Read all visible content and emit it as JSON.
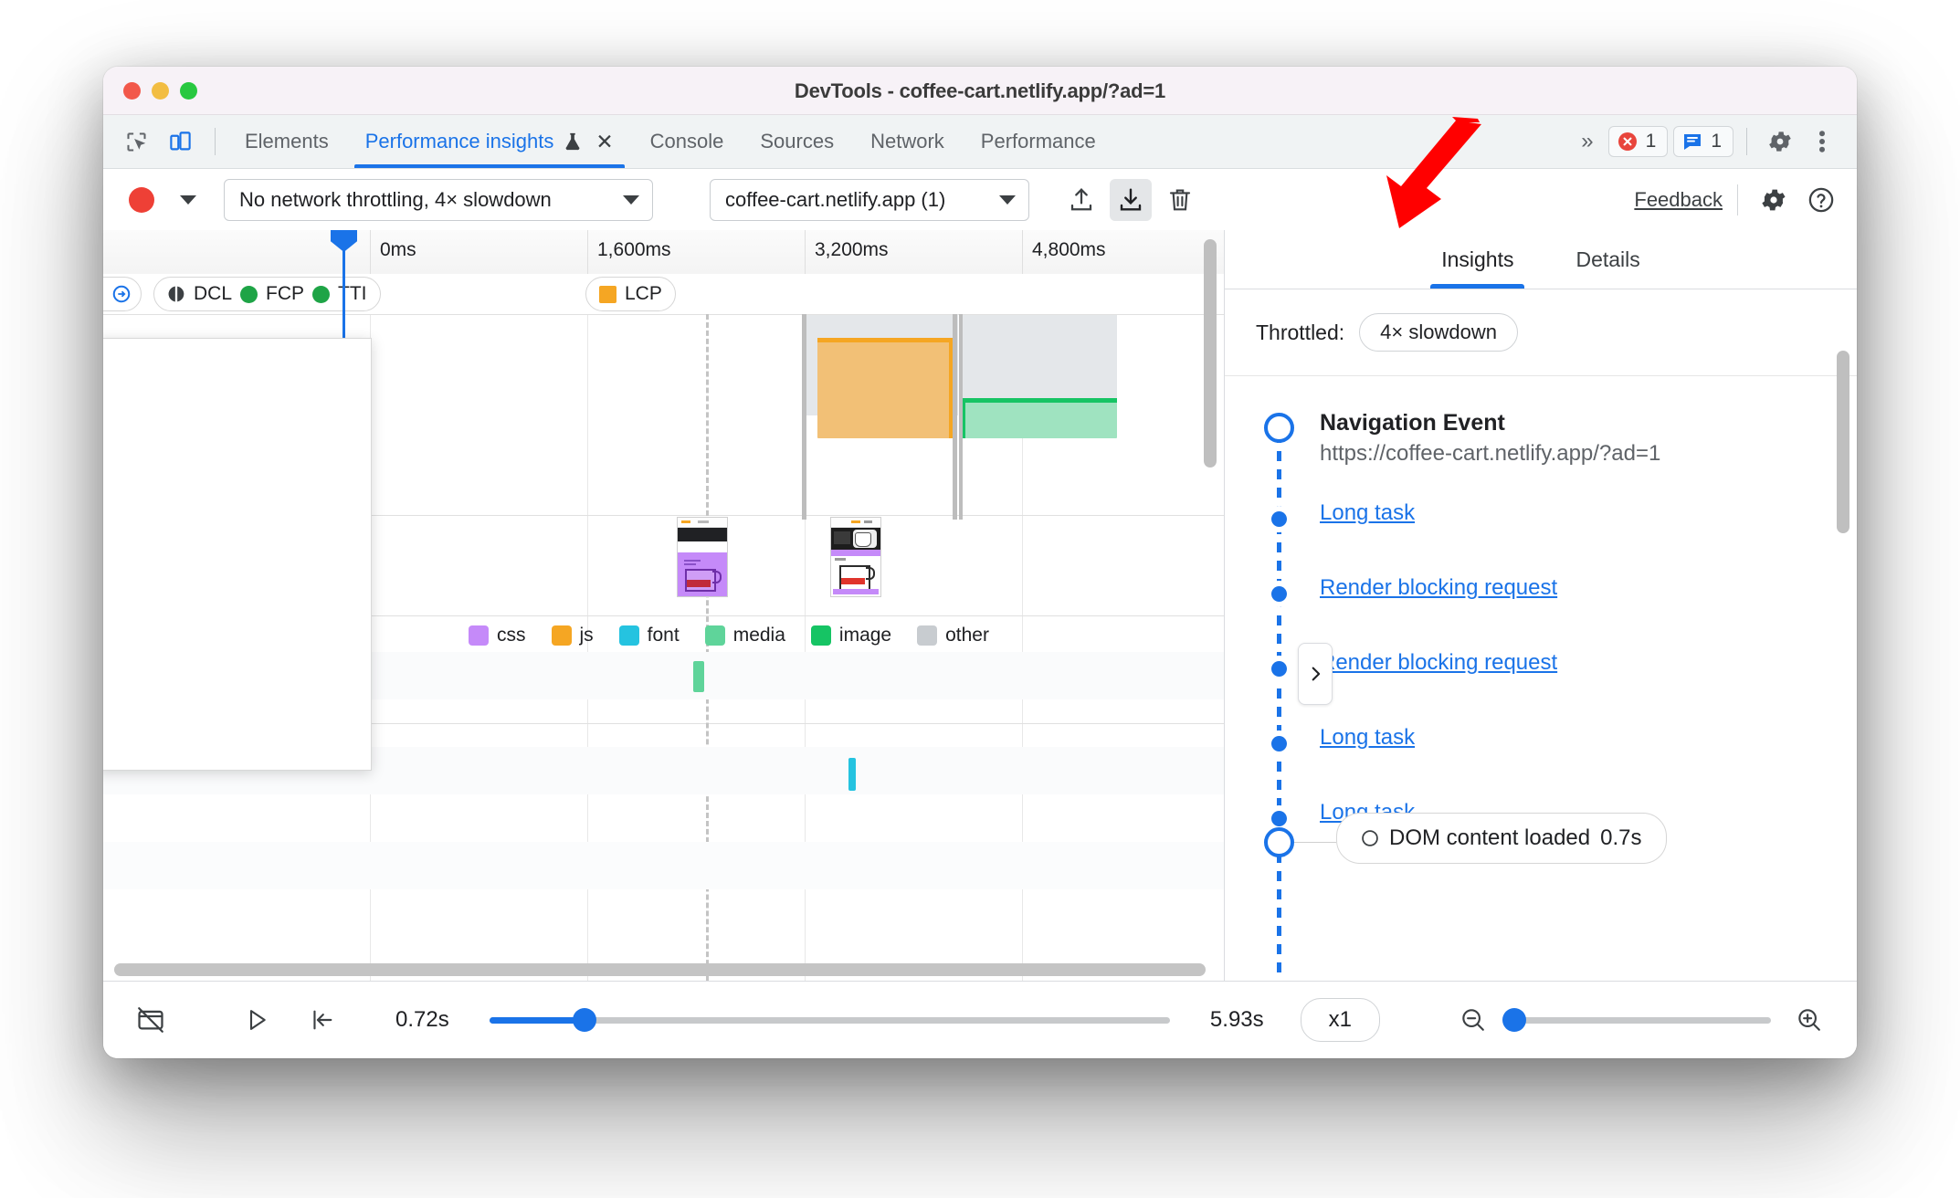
{
  "window": {
    "title": "DevTools - coffee-cart.netlify.app/?ad=1",
    "traffic_lights": [
      "close",
      "minimize",
      "zoom"
    ]
  },
  "tabstrip": {
    "left_icons": [
      "inspect-element-icon",
      "device-toolbar-icon"
    ],
    "tabs": [
      {
        "label": "Elements",
        "active": false
      },
      {
        "label": "Performance insights",
        "active": true,
        "experimental": true,
        "closable": true
      },
      {
        "label": "Console",
        "active": false
      },
      {
        "label": "Sources",
        "active": false
      },
      {
        "label": "Network",
        "active": false
      },
      {
        "label": "Performance",
        "active": false
      }
    ],
    "overflow_label": "»",
    "error_count": "1",
    "message_count": "1",
    "settings_icon": "gear-icon",
    "more_icon": "kebab-menu-icon"
  },
  "toolbar": {
    "record_button": "record-icon",
    "record_dropdown": "chevron-down-icon",
    "throttling_value": "No network throttling, 4× slowdown",
    "page_select_value": "coffee-cart.netlify.app (1)",
    "upload_label": "upload-icon",
    "download_label": "download-icon",
    "delete_label": "trash-icon",
    "feedback_label": "Feedback",
    "settings_icon": "gear-icon",
    "help_icon": "help-icon"
  },
  "timeline": {
    "ticks": [
      "0ms",
      "1,600ms",
      "3,200ms",
      "4,800ms"
    ],
    "markers": [
      {
        "label": "DCL",
        "type": "half-circle",
        "color": "#3c4043"
      },
      {
        "label": "FCP",
        "type": "circle",
        "color": "#1ea446"
      },
      {
        "label": "TTI",
        "type": "circle",
        "color": "#1ea446"
      },
      {
        "label": "LCP",
        "type": "square",
        "color": "#f5a623"
      }
    ],
    "legend": [
      {
        "label": "css",
        "color": "#c58af9"
      },
      {
        "label": "js",
        "color": "#f5a623"
      },
      {
        "label": "font",
        "color": "#25c3e0"
      },
      {
        "label": "media",
        "color": "#16c464"
      },
      {
        "label": "image",
        "color": "#5fd49a"
      },
      {
        "label": "other",
        "color": "#c8ccd0"
      }
    ],
    "legend_order": [
      "css",
      "js",
      "font",
      "image",
      "media",
      "other"
    ],
    "expander_icon": "triangle-right-icon",
    "collapse_sidebar_icon": "chevron-right-icon"
  },
  "sidebar": {
    "tabs": [
      {
        "label": "Insights",
        "active": true
      },
      {
        "label": "Details",
        "active": false
      }
    ],
    "throttled_label": "Throttled:",
    "throttled_value": "4× slowdown",
    "navigation": {
      "title": "Navigation Event",
      "url": "https://coffee-cart.netlify.app/?ad=1"
    },
    "items": [
      {
        "label": "Long task"
      },
      {
        "label": "Render blocking request"
      },
      {
        "label": "Render blocking request"
      },
      {
        "label": "Long task"
      },
      {
        "label": "Long task"
      }
    ],
    "footer_marker": {
      "label": "DOM content loaded",
      "time": "0.7s"
    }
  },
  "bottombar": {
    "filmstrip_icon": "screenshot-off-icon",
    "play_icon": "play-icon",
    "reset_icon": "jump-to-start-icon",
    "start_time": "0.72s",
    "end_time": "5.93s",
    "speed": "x1",
    "zoom_out_icon": "zoom-out-icon",
    "zoom_in_icon": "zoom-in-icon",
    "range_knob_pct": 14,
    "zoom_knob_pct": 3
  },
  "annotation": {
    "arrow": "red-arrow-pointing-to-download-button"
  },
  "colors": {
    "accent": "#1a73e8",
    "record": "#ee4036",
    "titlebar": "#f7f2f7",
    "tabstrip": "#f0f3f4",
    "css": "#c58af9",
    "js": "#f5a623",
    "font": "#25c3e0",
    "image": "#5fd49a",
    "media": "#16c464",
    "other": "#c8ccd0"
  }
}
